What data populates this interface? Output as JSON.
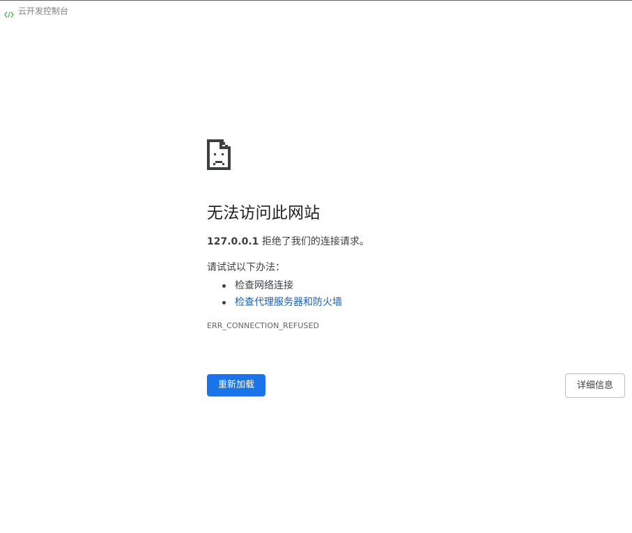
{
  "app": {
    "title": "云开发控制台",
    "icon": "code-brackets-icon",
    "icon_color": "#4caf50"
  },
  "error_page": {
    "icon": "sad-page-icon",
    "headline": "无法访问此网站",
    "host": "127.0.0.1",
    "summary_suffix": " 拒绝了我们的连接请求。",
    "suggestions_heading": "请试试以下办法：",
    "suggestions": [
      {
        "label": "检查网络连接",
        "is_link": false
      },
      {
        "label": "检查代理服务器和防火墙",
        "is_link": true
      }
    ],
    "error_code": "ERR_CONNECTION_REFUSED"
  },
  "buttons": {
    "reload_label": "重新加载",
    "details_label": "详细信息"
  },
  "colors": {
    "primary_button": "#1a73e8",
    "link": "#1a5fb4",
    "text": "#3c4043"
  }
}
